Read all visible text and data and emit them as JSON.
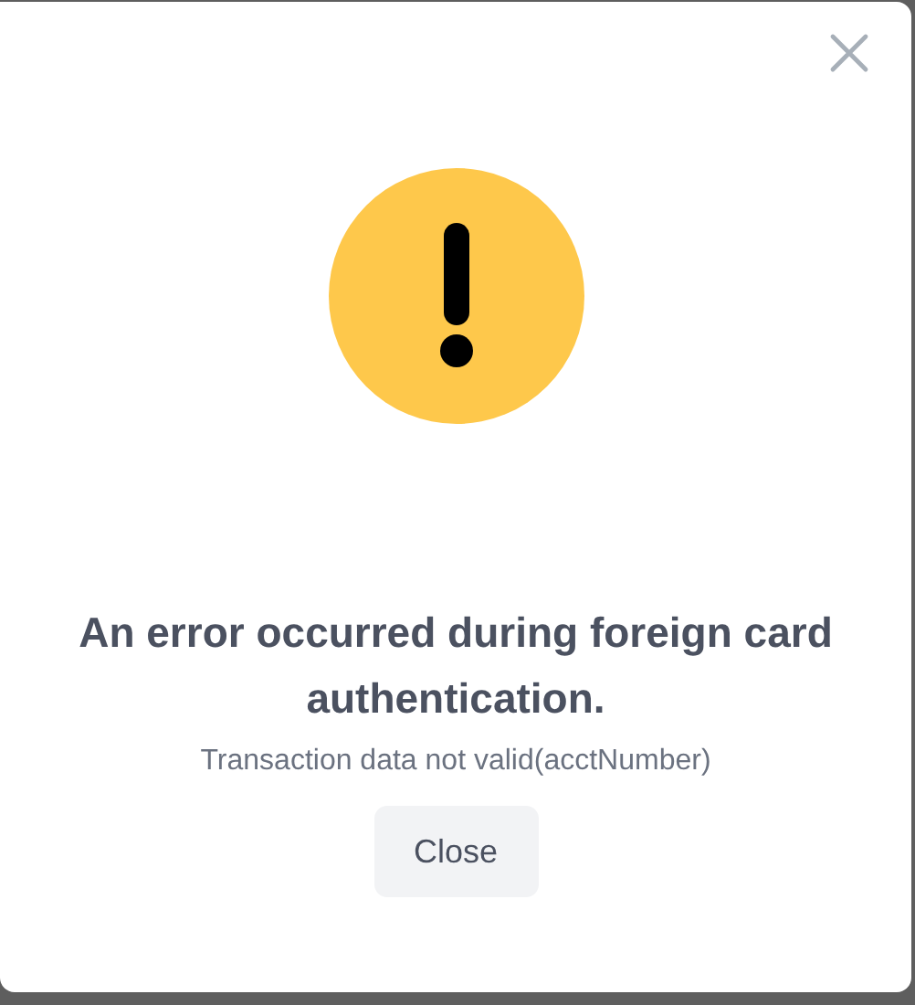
{
  "dialog": {
    "title": "An error occurred during foreign card authentication.",
    "message": "Transaction data not valid(acctNumber)",
    "buttons": [
      "Close"
    ]
  }
}
